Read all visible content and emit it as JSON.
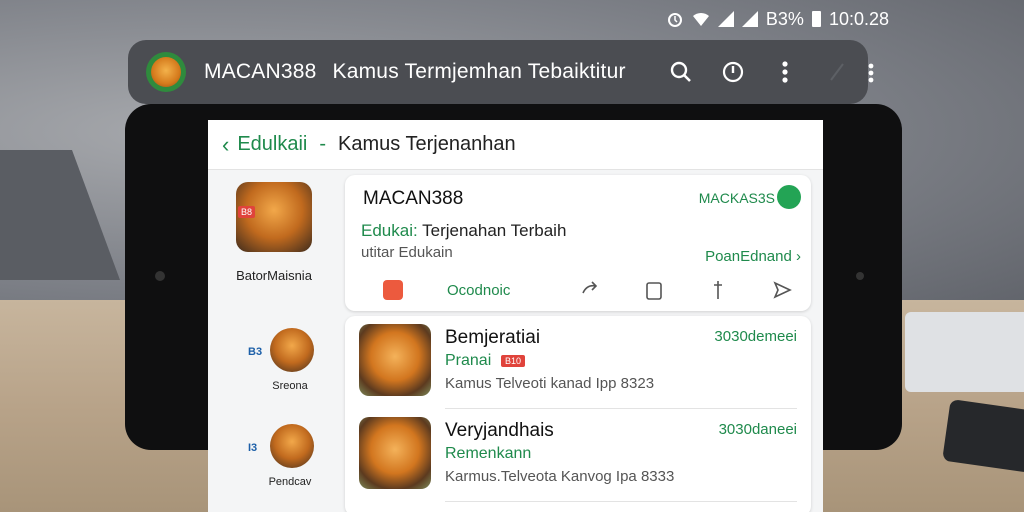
{
  "status_bar": {
    "battery": "B3%",
    "time": "10:0.28"
  },
  "top_bar": {
    "app_name": "MACAN388",
    "title": "Kamus Termjemhan Tebaiktitur"
  },
  "app_bar": {
    "brand": "Edulkaii",
    "separator": "-",
    "page": "Kamus Terjenanhan"
  },
  "sidebar": {
    "items": [
      {
        "tag": "B8",
        "label": "BatorMaisnia"
      },
      {
        "tag": "B3",
        "label": "Sreona"
      },
      {
        "tag": "I3",
        "label": "Pendcav"
      }
    ]
  },
  "top_card": {
    "name": "MACAN388",
    "badge": "MACKAS3S",
    "line1_brand": "Edukai:",
    "line1_text": "Terjenahan Terbaih",
    "line2": "utitar Edukain",
    "link": "PoanEdnand ›",
    "action_text": "Ocodnoic"
  },
  "list": {
    "items": [
      {
        "title": "Bemjeratiai",
        "subtitle": "Pranai",
        "tag": "B10",
        "desc": "Kamus Telveoti kanad Ipp 8323",
        "price": "3030demeei"
      },
      {
        "title": "Veryjandhais",
        "subtitle": "Remenkann",
        "tag": "",
        "desc": "Karmus.Telveota Kanvog Ipa 8333",
        "price": "3030daneei"
      }
    ]
  },
  "colors": {
    "accent": "#1f8a4c",
    "topbar": "#4b4d52",
    "danger": "#e0433b"
  }
}
